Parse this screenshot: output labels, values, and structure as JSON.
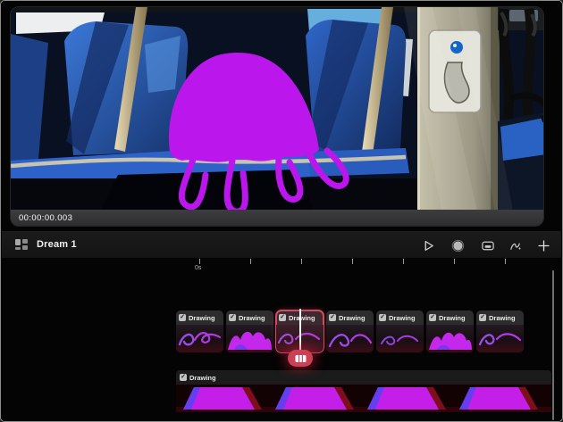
{
  "preview": {
    "timecode": "00:00:00.003"
  },
  "timeline_header": {
    "title": "Dream 1",
    "toolbar_icons": [
      "play-icon",
      "record-icon",
      "stage-icon",
      "draw-icon",
      "add-icon"
    ]
  },
  "ruler": {
    "start_label": "0s"
  },
  "clips": [
    {
      "label": "Drawing",
      "checked": true
    },
    {
      "label": "Drawing",
      "checked": true
    },
    {
      "label": "Drawing",
      "checked": true,
      "selected": true
    },
    {
      "label": "Drawing",
      "checked": true
    },
    {
      "label": "Drawing",
      "checked": true
    },
    {
      "label": "Drawing",
      "checked": true
    },
    {
      "label": "Drawing",
      "checked": true
    }
  ],
  "selected_clip_index": 2,
  "bottom_track": {
    "label": "Drawing",
    "checked": true
  },
  "icons": {
    "check": "✓"
  },
  "colors": {
    "drawing_magenta": "#bb16ec",
    "selection_red": "#d04a60",
    "badge_red": "#cb4056",
    "track_glow_red": "#7e0e1e",
    "seat_blue": "#2f66c8"
  }
}
